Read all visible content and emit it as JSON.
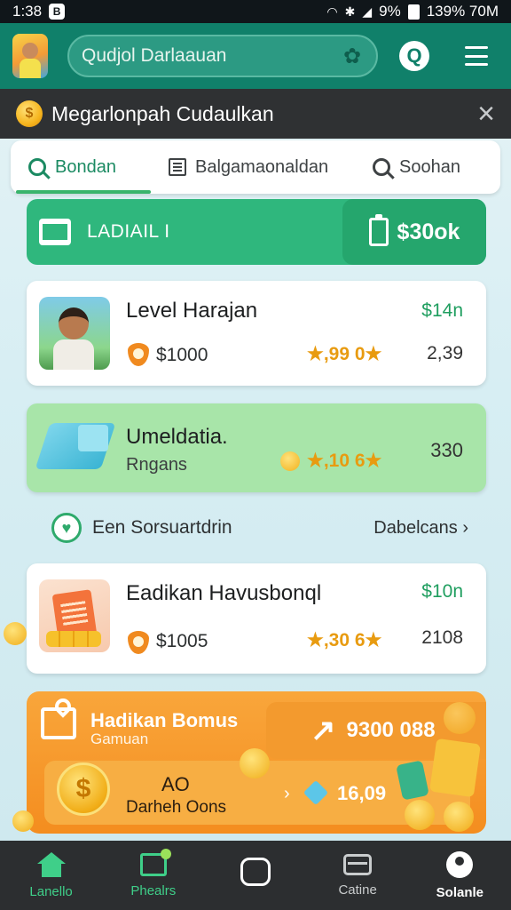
{
  "status_bar": {
    "time": "1:38",
    "lock_glyph": "B",
    "battery_text": "9%",
    "net_text": "139% 70M"
  },
  "app_bar": {
    "search_placeholder": "Qudjol Darlaauan",
    "q_button": "Q"
  },
  "panel": {
    "title": "Megarlonpah Cudaulkan",
    "close": "×"
  },
  "tabs": [
    {
      "label": "Bondan",
      "icon": "search-icon",
      "active": true
    },
    {
      "label": "Balgamaonaldan",
      "icon": "document-icon",
      "active": false
    },
    {
      "label": "Soohan",
      "icon": "search-icon",
      "active": false
    }
  ],
  "banner": {
    "label": "LADIAIL I",
    "amount": "$30ok"
  },
  "cards": [
    {
      "title": "Level Harajan",
      "price_left": "$1000",
      "rating": "★,99 0★",
      "price_right": "$14n",
      "count": "2,39"
    },
    {
      "title": "Umeldatia.",
      "subtitle": "Rngans",
      "rating": "★,10 6★",
      "count": "330"
    },
    {
      "title": "Eadikan Havusbonql",
      "price_left": "$1005",
      "rating": "★,30 6★",
      "price_right": "$10n",
      "count": "2108"
    }
  ],
  "section": {
    "label": "Een Sorsuartdrin",
    "link": "Dabelcans ›"
  },
  "promo": {
    "title": "Hadikan Bomus",
    "subtitle": "Gamuan",
    "amount": "9300 088",
    "line1": "AO",
    "line2": "Darheh Oons",
    "value": "16,09",
    "arrow": "›"
  },
  "bottom_nav": [
    {
      "label": "Lanello",
      "icon": "home-icon"
    },
    {
      "label": "Phealrs",
      "icon": "frame-icon"
    },
    {
      "label": "",
      "icon": "circle-icon"
    },
    {
      "label": "Catine",
      "icon": "tray-icon"
    },
    {
      "label": "Solanle",
      "icon": "user-icon"
    }
  ],
  "colors": {
    "accent_green": "#2fb77d",
    "app_bar": "#10806a",
    "promo_orange": "#f48d1f",
    "price_green": "#1f9e5f"
  }
}
